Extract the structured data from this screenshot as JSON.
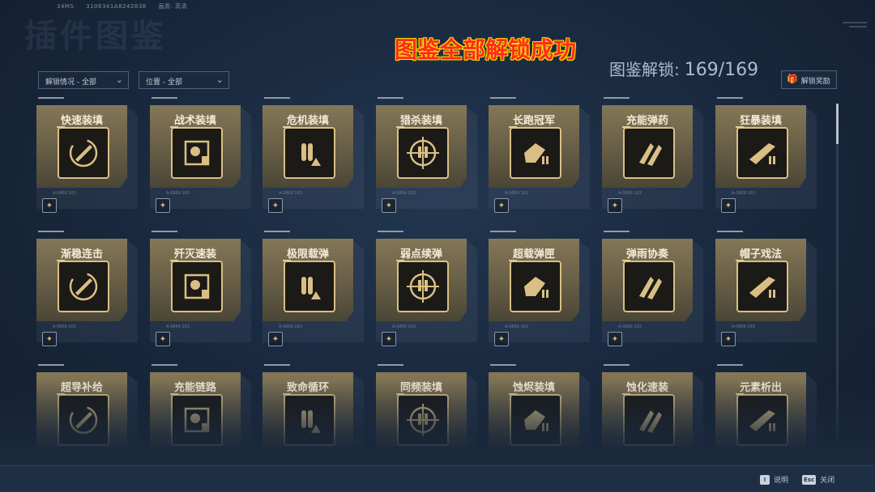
{
  "top_info": [
    "34MS",
    "3106341A8242838",
    "画质: 高清"
  ],
  "background_title": "插件图鉴",
  "unlock_message": "图鉴全部解锁成功",
  "counter": {
    "label": "图鉴解锁:",
    "value": "169/169"
  },
  "filters": {
    "unlock_status": "解锁情况 - 全部",
    "position": "位置 - 全部"
  },
  "reward_button": {
    "label": "解锁奖励",
    "icon": "gift-icon"
  },
  "cards": [
    {
      "name": "快速装填",
      "icon": "bullet-reload-icon",
      "badge": true
    },
    {
      "name": "战术装填",
      "icon": "tactical-head-icon",
      "badge": true
    },
    {
      "name": "危机装填",
      "icon": "crisis-bullets-icon",
      "badge": true
    },
    {
      "name": "猎杀装填",
      "icon": "crosshair-bullets-icon",
      "badge": true
    },
    {
      "name": "长跑冠军",
      "icon": "runner-icon",
      "badge": true
    },
    {
      "name": "充能弹药",
      "icon": "rocket-bullets-icon",
      "badge": true
    },
    {
      "name": "狂暴装填",
      "icon": "rage-gun-icon",
      "badge": true
    },
    {
      "name": "渐稳连击",
      "icon": "steady-combo-icon",
      "badge": true
    },
    {
      "name": "歼灭速装",
      "icon": "annihilate-bullets-icon",
      "badge": true
    },
    {
      "name": "极限载弹",
      "icon": "limit-magazine-icon",
      "badge": true
    },
    {
      "name": "弱点续弹",
      "icon": "weakpoint-arrow-icon",
      "badge": true
    },
    {
      "name": "超载弹匣",
      "icon": "overload-magazine-icon",
      "badge": true
    },
    {
      "name": "弹雨协奏",
      "icon": "bullet-rain-icon",
      "badge": true
    },
    {
      "name": "帽子戏法",
      "icon": "hat-trick-icon",
      "badge": true
    },
    {
      "name": "超导补给",
      "icon": "superconduct-icon",
      "badge": false
    },
    {
      "name": "充能链路",
      "icon": "charge-link-icon",
      "badge": false
    },
    {
      "name": "致命循环",
      "icon": "deadly-loop-icon",
      "badge": false
    },
    {
      "name": "同频装填",
      "icon": "sync-reload-icon",
      "badge": false
    },
    {
      "name": "蚀烬装填",
      "icon": "ember-reload-icon",
      "badge": false
    },
    {
      "name": "蚀化速装",
      "icon": "corrode-fast-icon",
      "badge": false
    },
    {
      "name": "元素析出",
      "icon": "element-extract-icon",
      "badge": false
    }
  ],
  "card_serial": "A-0869 163",
  "bottom_hints": [
    {
      "key": "!",
      "label": "说明"
    },
    {
      "key": "Esc",
      "label": "关闭"
    }
  ],
  "colors": {
    "accent_gold": "#d9bf84",
    "unlock_red": "#ff2a1c",
    "unlock_yellow": "#ffd800"
  }
}
